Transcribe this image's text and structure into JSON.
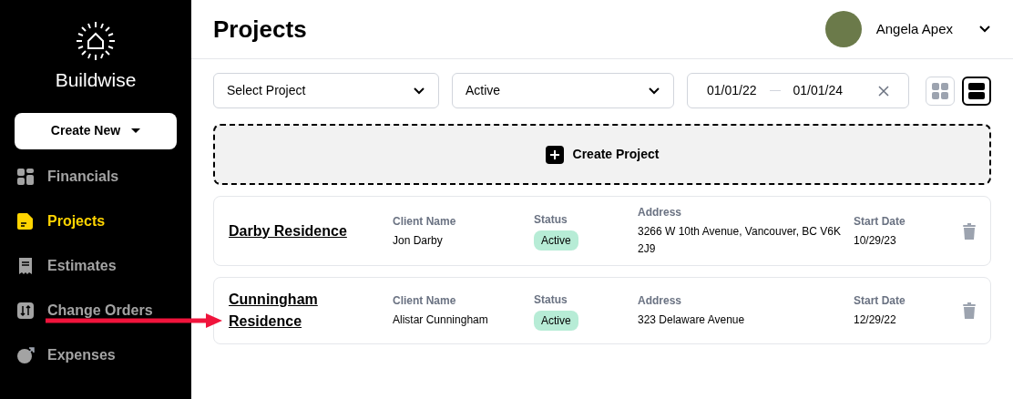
{
  "brand": {
    "name": "Buildwise"
  },
  "sidebar": {
    "create_button": "Create New",
    "items": [
      {
        "label": "Financials",
        "selected": false
      },
      {
        "label": "Projects",
        "selected": true
      },
      {
        "label": "Estimates",
        "selected": false
      },
      {
        "label": "Change Orders",
        "selected": false
      },
      {
        "label": "Expenses",
        "selected": false
      }
    ]
  },
  "header": {
    "title": "Projects",
    "user": "Angela Apex"
  },
  "filters": {
    "project": {
      "placeholder": "Select Project"
    },
    "status": {
      "value": "Active"
    },
    "date_from": "01/01/22",
    "date_to": "01/01/24"
  },
  "view_toggle": [
    {
      "kind": "grid",
      "selected": false
    },
    {
      "kind": "list",
      "selected": true
    }
  ],
  "create_project": "Create Project",
  "projects": [
    {
      "name": "Darby Residence",
      "client_label": "Client Name",
      "client": "Jon Darby",
      "status_label": "Status",
      "status": "Active",
      "address_label": "Address",
      "address": "3266 W 10th Avenue, Vancouver, BC V6K 2J9",
      "date_label": "Start Date",
      "date": "10/29/23"
    },
    {
      "name": "Cunningham Residence",
      "client_label": "Client Name",
      "client": "Alistar Cunningham",
      "status_label": "Status",
      "status": "Active",
      "address_label": "Address",
      "address": "323 Delaware Avenue",
      "date_label": "Start Date",
      "date": "12/29/22"
    }
  ],
  "annotation": {
    "kind": "arrow",
    "color": "#f0143c"
  }
}
